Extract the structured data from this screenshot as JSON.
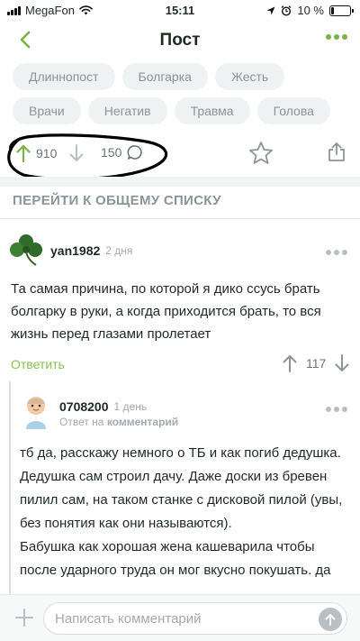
{
  "status_bar": {
    "carrier": "MegaFon",
    "time": "15:11",
    "battery": "10 %",
    "battery_level": 0.1
  },
  "nav": {
    "title": "Пост"
  },
  "tags": {
    "row1": [
      "Длиннопост",
      "Болгарка",
      "Жесть"
    ],
    "row2": [
      "Врачи",
      "Негатив",
      "Травма",
      "Голова"
    ]
  },
  "post_actions": {
    "rating": "910",
    "comments_count": "150"
  },
  "goto_list": "ПЕРЕЙТИ К ОБЩЕМУ СПИСКУ",
  "comment1": {
    "username": "yan1982",
    "time": "2 дня",
    "text": "Та самая причина, по которой я дико ссусь брать болгарку в руки, а когда приходится брать, то вся жизнь перед глазами пролетает",
    "reply_label": "Ответить",
    "rating": "117"
  },
  "comment2": {
    "username": "0708200",
    "time": "1 день",
    "reply_prefix": "Ответ на",
    "reply_target": "комментарий",
    "text": "тб да, расскажу немного о ТБ и как погиб дедушка.\nДедушка сам строил дачу. Даже доски из бревен пилил сам, на таком станке с дисковой пилой (увы, без понятия как они называются).\nБабушка как хорошая жена кашеварила чтобы после ударного труда он мог вкусно покушать. да"
  },
  "comment_input": {
    "placeholder": "Написать комментарий"
  },
  "colors": {
    "accent": "#79b344",
    "muted": "#8a9599",
    "tag_bg": "#eef2f2"
  },
  "icons": [
    "back-chevron-icon",
    "more-dots-icon",
    "arrow-up-icon",
    "arrow-down-icon",
    "comment-bubble-icon",
    "star-icon",
    "share-icon",
    "clover-avatar-icon",
    "plus-icon",
    "send-arrow-icon"
  ]
}
